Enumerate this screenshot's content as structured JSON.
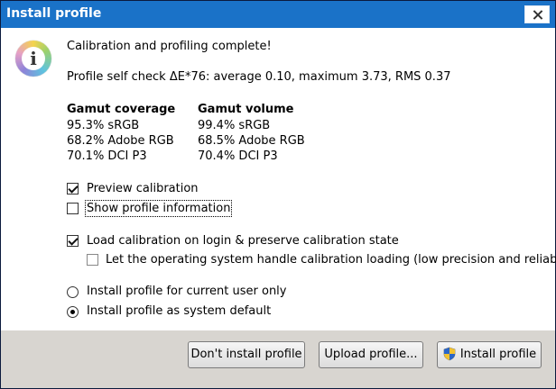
{
  "window": {
    "title": "Install profile"
  },
  "message": {
    "line1": "Calibration and profiling complete!",
    "line2": "Profile self check ΔE*76: average 0.10, maximum 3.73, RMS 0.37"
  },
  "gamut": {
    "coverage": {
      "header": "Gamut coverage",
      "rows": [
        "95.3% sRGB",
        "68.2% Adobe RGB",
        "70.1% DCI P3"
      ]
    },
    "volume": {
      "header": "Gamut volume",
      "rows": [
        "99.4% sRGB",
        "68.5% Adobe RGB",
        "70.4% DCI P3"
      ]
    }
  },
  "options": {
    "preview_calibration": {
      "label": "Preview calibration",
      "checked": true
    },
    "show_profile_information": {
      "label": "Show profile information",
      "checked": false
    },
    "load_calibration": {
      "label": "Load calibration on login & preserve calibration state",
      "checked": true
    },
    "os_handle_calibration": {
      "label": "Let the operating system handle calibration loading (low precision and reliability)",
      "checked": false
    }
  },
  "install_scope": {
    "current_user": {
      "label": "Install profile for current user only",
      "selected": false
    },
    "system_default": {
      "label": "Install profile as system default",
      "selected": true
    }
  },
  "buttons": {
    "dont_install": "Don't install profile",
    "upload": "Upload profile...",
    "install": "Install profile"
  },
  "icons": {
    "info": "info-icon",
    "shield": "uac-shield-icon",
    "close": "close-icon"
  },
  "colors": {
    "titlebar": "#1a72c8",
    "footer": "#d8d5d0"
  }
}
